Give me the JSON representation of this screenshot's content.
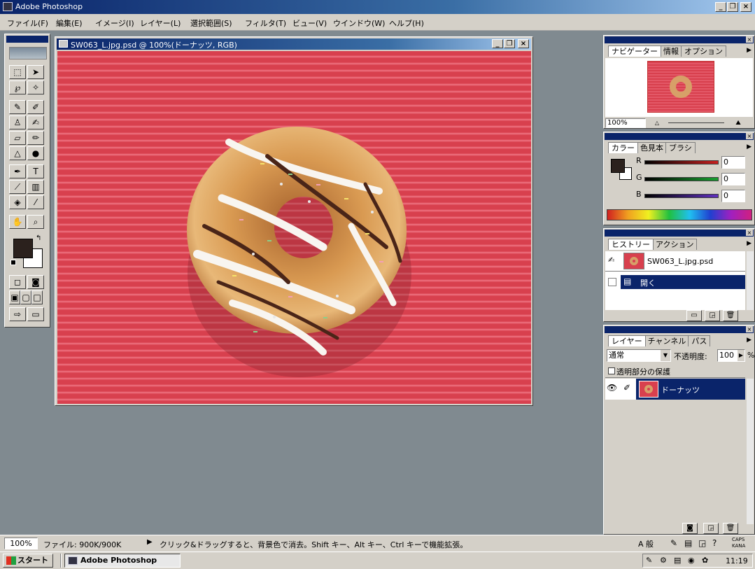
{
  "app": {
    "title": "Adobe Photoshop"
  },
  "menu": [
    "ファイル(F)",
    "編集(E)",
    "イメージ(I)",
    "レイヤー(L)",
    "選択範囲(S)",
    "フィルタ(T)",
    "ビュー(V)",
    "ウインドウ(W)",
    "ヘルプ(H)"
  ],
  "document": {
    "title": "SW063_L.jpg.psd @ 100%(ドーナッツ, RGB)"
  },
  "navigator": {
    "tabs": [
      "ナビゲーター",
      "情報",
      "オプション"
    ],
    "zoom": "100%"
  },
  "color": {
    "tabs": [
      "カラー",
      "色見本",
      "ブラシ"
    ],
    "r_label": "R",
    "g_label": "G",
    "b_label": "B",
    "r": "0",
    "g": "0",
    "b": "0"
  },
  "history": {
    "tabs": [
      "ヒストリー",
      "アクション"
    ],
    "snapshot": "SW063_L.jpg.psd",
    "step": "開く"
  },
  "layers": {
    "tabs": [
      "レイヤー",
      "チャンネル",
      "パス"
    ],
    "blend_mode": "通常",
    "opacity_label": "不透明度:",
    "opacity": "100",
    "opacity_unit": "%",
    "preserve_label": "透明部分の保護",
    "layer_name": "ドーナッツ"
  },
  "status": {
    "zoom": "100%",
    "file_info": "ファイル: 900K/900K",
    "hint": "クリック&ドラッグすると、背景色で消去。Shift キー、Alt キー、Ctrl キーで機能拡張。"
  },
  "taskbar": {
    "start": "スタート",
    "task": "Adobe Photoshop",
    "ime": "A 般",
    "clock": "11:19",
    "caps": "CAPS",
    "kana": "KANA"
  },
  "window_controls": {
    "minimize": "_",
    "restore": "❐",
    "close": "×"
  },
  "colors": {
    "canvas_red": "#d8404e",
    "titlebar": "#0a246a",
    "selection": "#0a246a",
    "workspace": "#808a90"
  }
}
